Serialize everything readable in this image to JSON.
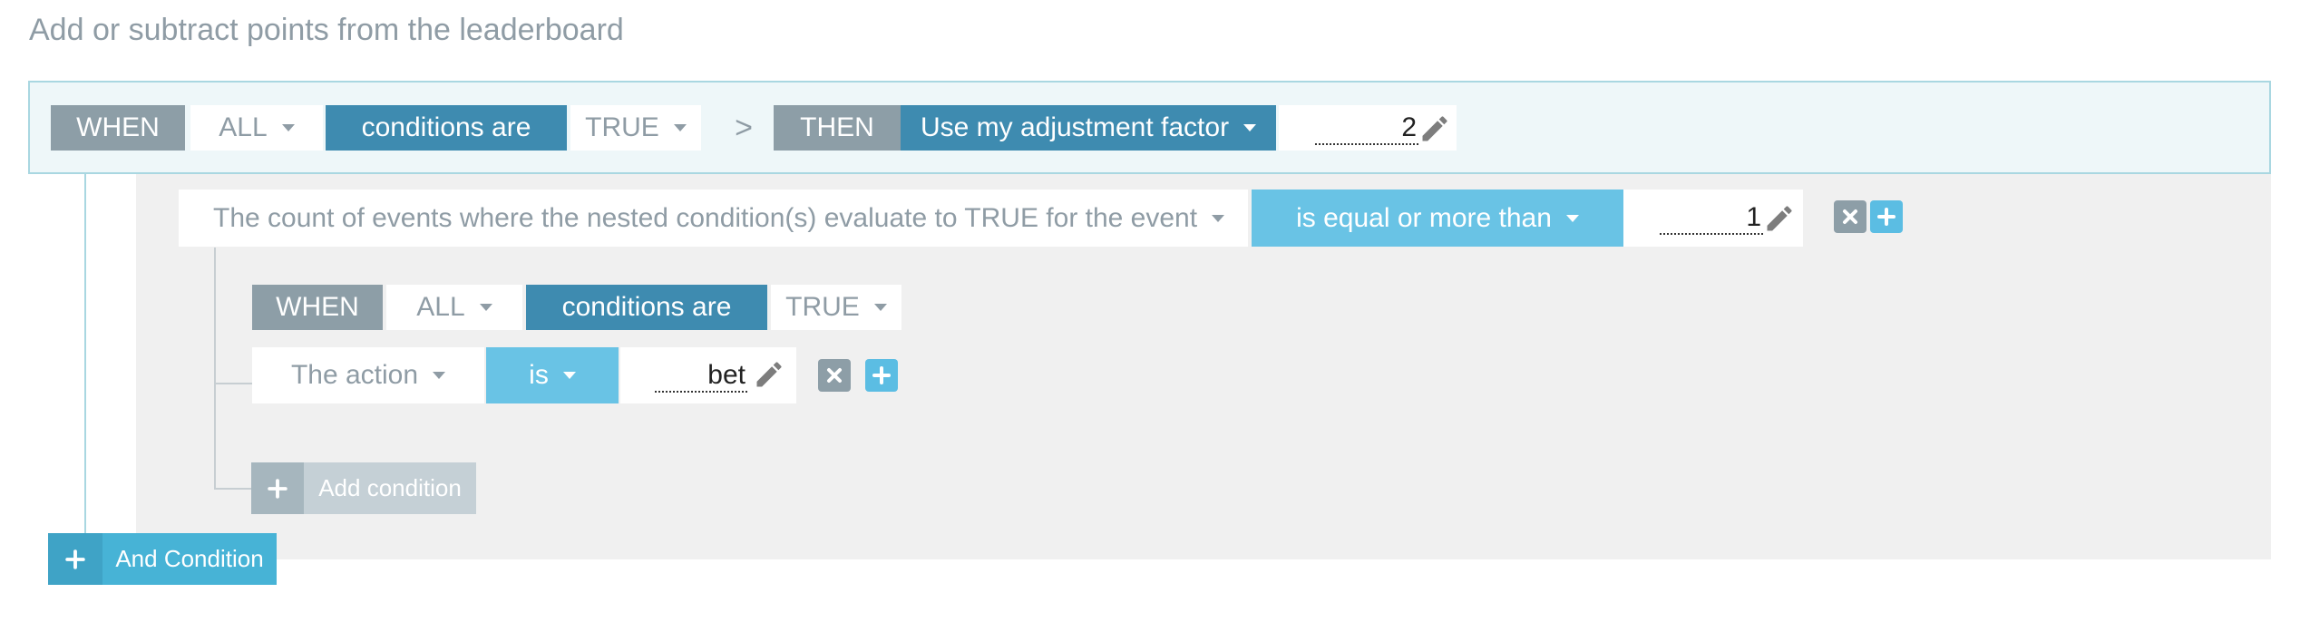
{
  "title": "Add or subtract points from the leaderboard",
  "top_rule": {
    "when": "WHEN",
    "quantifier": "ALL",
    "conditions_are": "conditions are",
    "truth": "TRUE",
    "arrow": ">",
    "then": "THEN",
    "action": "Use my adjustment factor",
    "factor_value": "2"
  },
  "count_condition": {
    "subject": "The count of events where the nested condition(s) evaluate to TRUE for the event",
    "operator": "is equal or more than",
    "value": "1"
  },
  "nested_rule": {
    "when": "WHEN",
    "quantifier": "ALL",
    "conditions_are": "conditions are",
    "truth": "TRUE"
  },
  "action_condition": {
    "subject": "The action",
    "operator": "is",
    "value": "bet"
  },
  "buttons": {
    "add_condition": "Add condition",
    "and_condition": "And Condition"
  },
  "icons": {
    "dropdown": "chevron-down-icon",
    "edit": "pencil-icon",
    "remove": "close-icon",
    "add": "plus-icon"
  },
  "colors": {
    "label_grey": "#8d9ea7",
    "label_blue": "#3e8bb0",
    "label_light_blue": "#69c3e5",
    "panel_border": "#a9d7e1",
    "panel_bg": "#eef7f9",
    "nested_bg": "#f0f0f0",
    "and_condition_bg": "#47b3d6"
  }
}
